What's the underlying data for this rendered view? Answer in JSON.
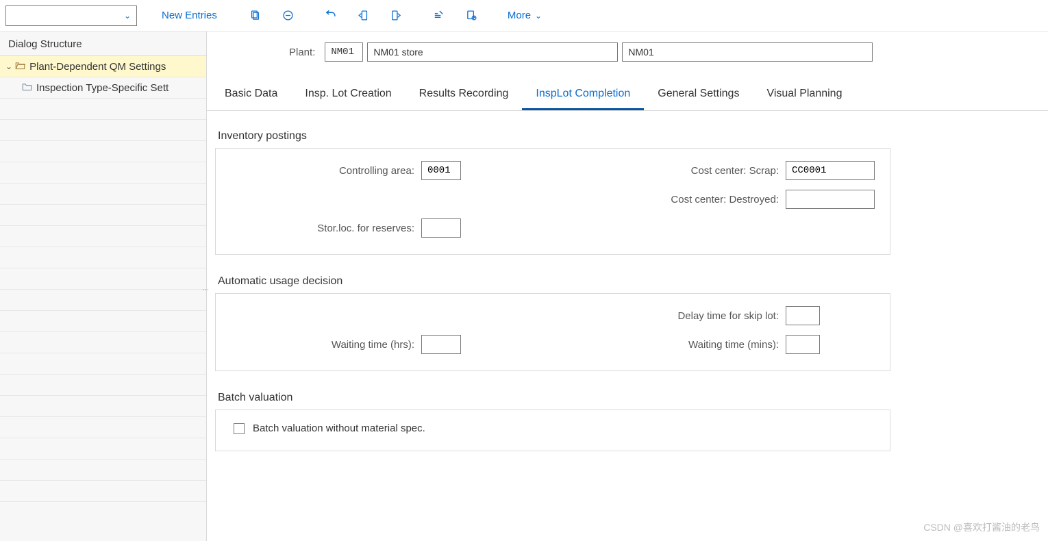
{
  "toolbar": {
    "new_entries": "New Entries",
    "more": "More"
  },
  "sidebar": {
    "title": "Dialog Structure",
    "items": [
      {
        "label": "Plant-Dependent QM Settings",
        "expanded": true,
        "selected": true
      },
      {
        "label": "Inspection Type-Specific Sett",
        "expanded": false,
        "selected": false
      }
    ]
  },
  "header": {
    "plant_label": "Plant:",
    "plant_code": "NM01",
    "plant_name": "NM01 store",
    "plant_extra": "NM01"
  },
  "tabs": [
    {
      "label": "Basic Data",
      "active": false
    },
    {
      "label": "Insp. Lot Creation",
      "active": false
    },
    {
      "label": "Results Recording",
      "active": false
    },
    {
      "label": "InspLot Completion",
      "active": true
    },
    {
      "label": "General Settings",
      "active": false
    },
    {
      "label": "Visual Planning",
      "active": false
    }
  ],
  "sections": {
    "inventory": {
      "title": "Inventory postings",
      "controlling_area_label": "Controlling area:",
      "controlling_area": "0001",
      "cost_center_scrap_label": "Cost center: Scrap:",
      "cost_center_scrap": "CC0001",
      "cost_center_destroyed_label": "Cost center: Destroyed:",
      "cost_center_destroyed": "",
      "storloc_label": "Stor.loc. for reserves:",
      "storloc": ""
    },
    "auto_ud": {
      "title": "Automatic usage decision",
      "delay_label": "Delay time for skip lot:",
      "delay": "",
      "wait_hrs_label": "Waiting time (hrs):",
      "wait_hrs": "",
      "wait_mins_label": "Waiting time (mins):",
      "wait_mins": ""
    },
    "batch_val": {
      "title": "Batch valuation",
      "checkbox_label": "Batch valuation without material spec."
    }
  },
  "watermark": "CSDN @喜欢打酱油的老鸟"
}
